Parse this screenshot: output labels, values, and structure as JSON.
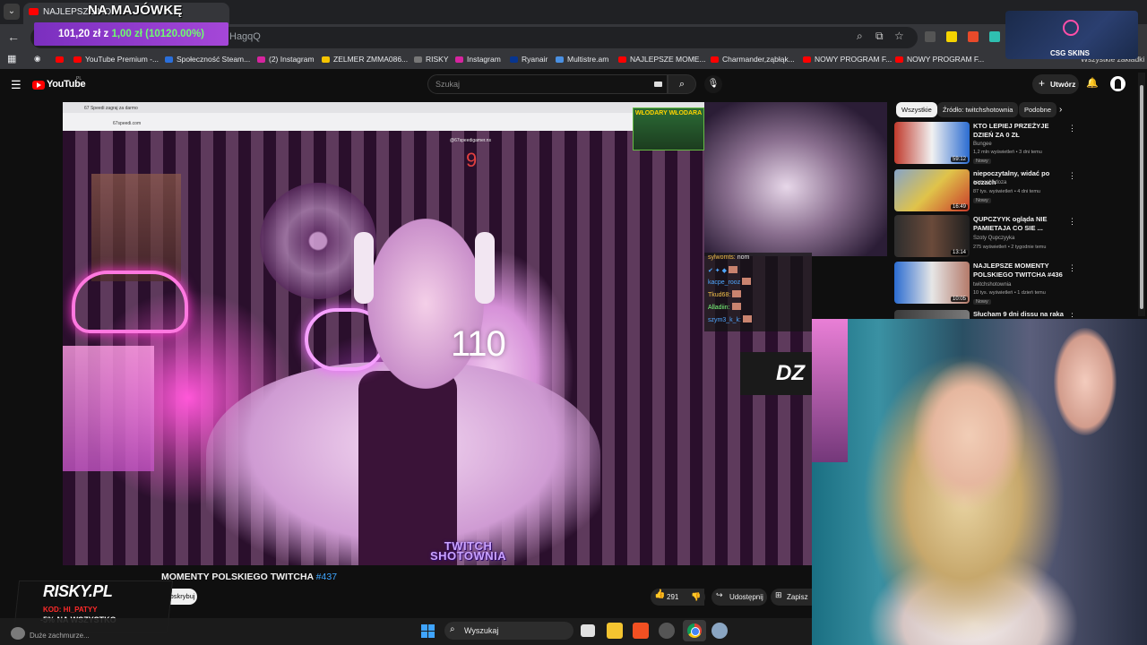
{
  "browser": {
    "tab_title": "NAJLEPSZE MO",
    "overlay_title": "NA MAJÓWKĘ",
    "address_text": "HagqQ",
    "promo": {
      "left": "101,20 zł z ",
      "right": "1,00 zł (10120.00%)"
    }
  },
  "bookmarks": [
    {
      "label": "YouTube Premium -...",
      "color": "#ff0000"
    },
    {
      "label": "Społeczność Steam...",
      "color": "#2a6fdb"
    },
    {
      "label": "(2) Instagram",
      "color": "#d6249f"
    },
    {
      "label": "ZELMER ZMMA086...",
      "color": "#f5c400"
    },
    {
      "label": "RISKY",
      "color": "#444444"
    },
    {
      "label": "Instagram",
      "color": "#d6249f"
    },
    {
      "label": "Ryanair",
      "color": "#073590"
    },
    {
      "label": "Multistre.am",
      "color": "#4a90e2"
    },
    {
      "label": "NAJLEPSZE MOME...",
      "color": "#ff0000"
    },
    {
      "label": "Charmander,ząbłąk...",
      "color": "#ff0000"
    },
    {
      "label": "NOWY PROGRAM F...",
      "color": "#ff0000"
    },
    {
      "label": "NOWY PROGRAM F...",
      "color": "#ff0000"
    }
  ],
  "bookmarks_more": "Wszystkie zakładki",
  "csgo": {
    "label": "CSG  SKINS"
  },
  "youtube": {
    "logo": "YouTube",
    "country": "PL",
    "search_placeholder": "Szukaj",
    "create_label": "Utwórz"
  },
  "video": {
    "timer_small": "9",
    "counter": "110",
    "inner_tab": "67 Speedi zagraj za darmo",
    "inner_url": "67speedi.com",
    "inner_handle": "@67speedigamer.ns",
    "banner": "WŁODARY WŁODARA",
    "watermark_top": "TWITCH",
    "watermark_bottom": "SHOTOWNIA",
    "dz": "DZ",
    "chat": [
      {
        "user": "sylwomts:",
        "msg": "nom",
        "color": "#f5c24b"
      },
      {
        "user": "",
        "msg": "",
        "color": "#ffffff"
      },
      {
        "user": "kacpe_rooz",
        "msg": "",
        "color": "#4fa7ff"
      },
      {
        "user": "Tkud68:",
        "msg": "",
        "color": "#f5c24b"
      },
      {
        "user": "Alladiin:",
        "msg": "",
        "color": "#7cff7c"
      },
      {
        "user": "szym3_k_k:",
        "msg": "",
        "color": "#4fa7ff"
      }
    ]
  },
  "video_info": {
    "title": "NAJLEPSZE MOMENTY POLSKIEGO TWITCHA ",
    "title_visible": "MOMENTY POLSKIEGO TWITCHA ",
    "hashtag": "#437",
    "subscribe": "Subskrybuj",
    "likes": "291",
    "share": "Udostępnij",
    "save": "Zapisz",
    "comment_preview": "Duże zachmurze..."
  },
  "risky": {
    "logo": "RISKY.PL",
    "code": "KOD: HI_PATYY",
    "discount": "-5% NA WSZYSTKO"
  },
  "sidebar": {
    "chips": [
      "Wszystkie",
      "Źródło: twitchshotownia",
      "Podobne"
    ],
    "recommendations": [
      {
        "title": "KTO LEPIEJ PRZEŻYJE DZIEŃ ZA 0 ZŁ",
        "channel": "Bungee",
        "meta": "1,2 mln wyświetleń • 3 dni temu",
        "badge": "Nowy",
        "duration": "59:12",
        "thumb": "linear-gradient(90deg,#c0392b,#f1f1f1 50%,#2b6cd1)"
      },
      {
        "title": "niepoczytalny, widać po oczach",
        "channel": "samochodoza",
        "meta": "87 tys. wyświetleń • 4 dni temu",
        "badge": "Nowy",
        "duration": "16:49",
        "thumb": "linear-gradient(135deg,#86a4c9,#e0c34a 50%,#c83a2a)"
      },
      {
        "title": "QUPCZYYK ogląda NIE PAMIETAJA CO SIE ...",
        "channel": "Szoty Qupczyyka",
        "meta": "275 wyświetleń • 2 tygodnie temu",
        "badge": "",
        "duration": "13:14",
        "thumb": "linear-gradient(90deg,#2d2d2d,#6a4a3a 50%,#1f1f1f)"
      },
      {
        "title": "NAJLEPSZE MOMENTY POLSKIEGO TWITCHA #436",
        "channel": "twitchshotownia",
        "meta": "10 tys. wyświetleń • 1 dzień temu",
        "badge": "Nowy",
        "duration": "10:05",
        "thumb": "linear-gradient(90deg,#2b6cd1,#e6e6e6 50%,#b47a6a)"
      },
      {
        "title": "Słucham 9 dni dissu na raka",
        "channel": "",
        "meta": "",
        "badge": "",
        "duration": "",
        "thumb": "linear-gradient(90deg,#3a3a3a,#7a7a7a)"
      }
    ]
  },
  "taskbar": {
    "search": "Wyszukaj",
    "apps": [
      {
        "name": "task-view",
        "color": "#e0e0e0"
      },
      {
        "name": "file-explorer",
        "color": "#f4c430"
      },
      {
        "name": "store",
        "color": "#f25022"
      },
      {
        "name": "app-red",
        "color": "#9a9a9a"
      },
      {
        "name": "settings",
        "color": "#8aa5c2"
      }
    ]
  }
}
